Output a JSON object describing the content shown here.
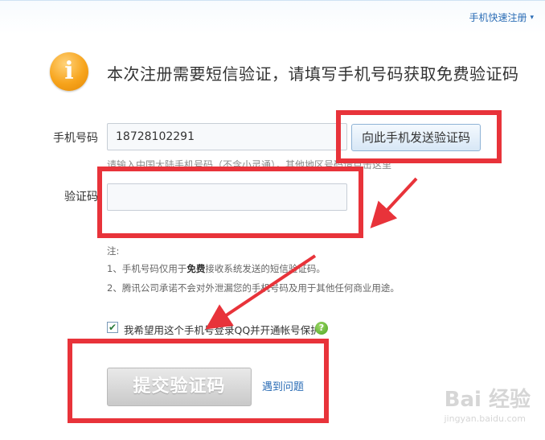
{
  "top_link": {
    "label": "手机快速注册",
    "caret": "▾"
  },
  "header": {
    "icon": "i",
    "text": "本次注册需要短信验证，请填写手机号码获取免费验证码"
  },
  "phone": {
    "label": "手机号码",
    "value": "18728102291",
    "send_button": "向此手机发送验证码",
    "hint": "请输入中国大陆手机号码（不含小灵通），其他地区号码请点击这里"
  },
  "code": {
    "label": "验证码",
    "value": ""
  },
  "notes": {
    "title": "注:",
    "line1_prefix": "1、手机号码仅用于",
    "line1_bold": "免费",
    "line1_suffix": "接收系统发送的短信验证码。",
    "line2": "2、腾讯公司承诺不会对外泄漏您的手机号码及用于其他任何商业用途。"
  },
  "option": {
    "checked": true,
    "label": "我希望用这个手机号登录QQ并开通帐号保护",
    "help_icon": "?"
  },
  "submit": {
    "label": "提交验证码"
  },
  "problem_link": "遇到问题",
  "watermark": {
    "text": "Bai 经验",
    "sub": "jingyan.baidu.com"
  },
  "annotation_color": "#e8333a"
}
